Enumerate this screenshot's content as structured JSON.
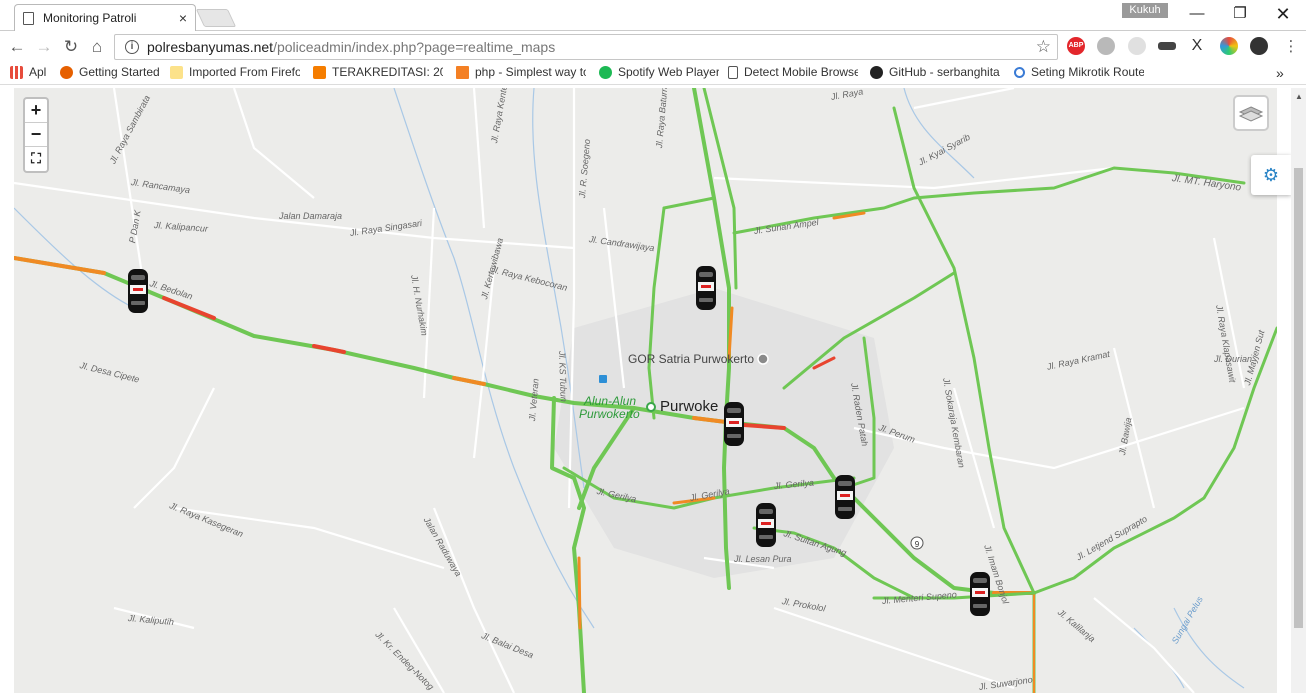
{
  "browser": {
    "tab_title": "Monitoring Patroli",
    "tab_close": "×",
    "profile_name": "Kukuh",
    "url_host": "polresbanyumas.net",
    "url_path": "/policeadmin/index.php?page=realtime_maps",
    "bookmarks": [
      {
        "label": "Apl",
        "icon": "apps-icon"
      },
      {
        "label": "Getting Started",
        "icon": "firefox-icon"
      },
      {
        "label": "Imported From Firefo",
        "icon": "folder-icon"
      },
      {
        "label": "TERAKREDITASI: 20 La",
        "icon": "blogger-icon"
      },
      {
        "label": "php - Simplest way to",
        "icon": "stackoverflow-icon"
      },
      {
        "label": "Spotify Web Player",
        "icon": "spotify-icon"
      },
      {
        "label": "Detect Mobile Browse",
        "icon": "page-icon"
      },
      {
        "label": "GitHub - serbanghita/",
        "icon": "github-icon"
      },
      {
        "label": "Seting Mikrotik Route",
        "icon": "mikrotik-icon"
      }
    ],
    "more_bookmarks": "»"
  },
  "map": {
    "controls": {
      "zoom_in": "+",
      "zoom_out": "−",
      "fullscreen": "⛶",
      "settings": "⚙"
    },
    "places": {
      "gor": "GOR Satria Purwokerto",
      "alun_line1": "Alun-Alun",
      "alun_line2": "Purwokerto",
      "city": "Purwoke"
    },
    "road_labels": [
      "Jl. Raya Sambirata",
      "Jl. Rancamaya",
      "Jl. Kalipancur",
      "Jalan Damaraja",
      "Jl. Raya Singasari",
      "Jl. H. Nurhakim",
      "Jl. Raya Kebocoran",
      "Jl. Candrawijaya",
      "Jl. R. Soegeno",
      "Jl. Raya Baturraden B",
      "Jl. Raya Kenteri",
      "Jl. Sunan Ampel",
      "Jl. Kyai Syarib",
      "Jl. MT. Haryono",
      "Jl. Raya Klapasawit",
      "Jl. Durian",
      "Jl. Raya Kramat",
      "Jl. Sokaraja Kembaran",
      "Jl. Raden Patah",
      "Jl. Perum",
      "Jl. Bawija",
      "Jl. Imam Bonjol",
      "Jl. Letjend Suprapto",
      "Jl. Kalilanja",
      "Jl. Menteri Supeno",
      "Jl. Prokolol",
      "Jl. Lesan Pura",
      "Jl. Sultan Agung",
      "Jl. Gerilya",
      "Jl. Gerilya",
      "Jl. Gerilya",
      "Jl. Veteran",
      "Jl. KS Tubun",
      "Jl. Kertawibawa",
      "Jl. Bedolan",
      "Jl. Desa Cipete",
      "Jl. Raya Kasegeran",
      "Jalan Raduwaya",
      "Jl. Kaliputih",
      "Jl. Kr. Endeg-Notog",
      "Jl. Balai Desa",
      "Jl. Suwarjono",
      "Jl. Mayjen Sut",
      "Jl. Raya",
      "Sungai Pelus",
      "P Dan K"
    ],
    "route_number": "9",
    "vehicles": [
      "patrol-car-1",
      "patrol-car-2",
      "patrol-car-3",
      "patrol-car-4",
      "patrol-car-5",
      "patrol-car-6"
    ]
  }
}
